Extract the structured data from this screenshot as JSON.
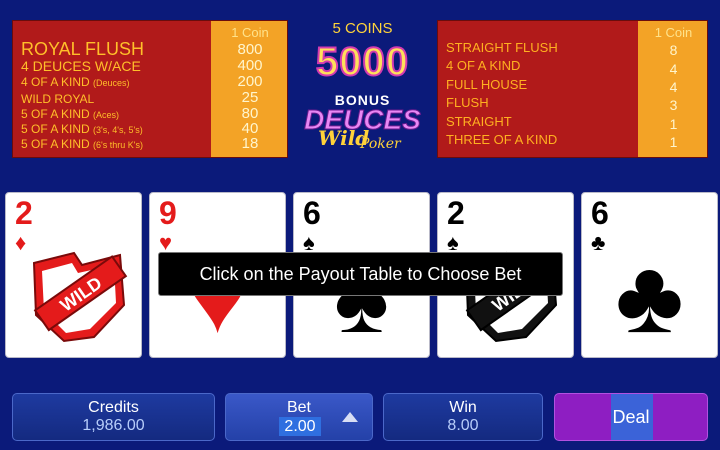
{
  "paytable_left": {
    "coins_header": "1 Coin",
    "rows": [
      {
        "hand": "ROYAL FLUSH",
        "qualifier": "",
        "payout": "800"
      },
      {
        "hand": "4 DEUCES w/ACE",
        "qualifier": "",
        "payout": "400"
      },
      {
        "hand": "4 OF A KIND",
        "qualifier": "(Deuces)",
        "payout": "200"
      },
      {
        "hand": "WILD ROYAL",
        "qualifier": "",
        "payout": "25"
      },
      {
        "hand": "5 OF A KIND",
        "qualifier": "(Aces)",
        "payout": "80"
      },
      {
        "hand": "5 OF A KIND",
        "qualifier": "(3's, 4's, 5's)",
        "payout": "40"
      },
      {
        "hand": "5 OF A KIND",
        "qualifier": "(6's thru K's)",
        "payout": "18"
      }
    ]
  },
  "paytable_right": {
    "coins_header": "1 Coin",
    "rows": [
      {
        "hand": "STRAIGHT FLUSH",
        "payout": "8"
      },
      {
        "hand": "4 OF A KIND",
        "payout": "4"
      },
      {
        "hand": "FULL HOUSE",
        "payout": "4"
      },
      {
        "hand": "FLUSH",
        "payout": "3"
      },
      {
        "hand": "STRAIGHT",
        "payout": "1"
      },
      {
        "hand": "THREE OF A KIND",
        "payout": "1"
      }
    ]
  },
  "jackpot": {
    "coins_label": "5 COINS",
    "amount": "5000"
  },
  "logo": {
    "bonus": "BONUS",
    "deuces": "DEUCES",
    "wild": "Wild",
    "poker": "Poker"
  },
  "cards": [
    {
      "rank": "2",
      "suit": "♦",
      "suit_name": "diamonds",
      "color": "red",
      "wild": true,
      "wild_text": "WILD"
    },
    {
      "rank": "9",
      "suit": "♥",
      "suit_name": "hearts",
      "color": "red",
      "wild": false
    },
    {
      "rank": "6",
      "suit": "♠",
      "suit_name": "spades",
      "color": "black",
      "wild": false
    },
    {
      "rank": "2",
      "suit": "♠",
      "suit_name": "spades",
      "color": "black",
      "wild": true,
      "wild_text": "WILD"
    },
    {
      "rank": "6",
      "suit": "♣",
      "suit_name": "clubs",
      "color": "black",
      "wild": false
    }
  ],
  "tooltip": "Click on the Payout Table to Choose Bet",
  "controls": {
    "credits_label": "Credits",
    "credits_value": "1,986.00",
    "bet_label": "Bet",
    "bet_value": "2.00",
    "win_label": "Win",
    "win_value": "8.00",
    "deal_label": "Deal"
  },
  "colors": {
    "background": "#0b1a7a",
    "paytable_red": "#b11a1a",
    "coins_column": "#f3a326",
    "deal_purple": "#8e1ec2"
  }
}
